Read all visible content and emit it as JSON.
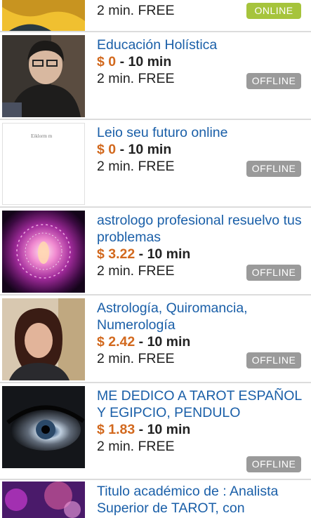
{
  "listings": [
    {
      "title": "",
      "currency": "",
      "price": "",
      "per": "",
      "free": "2 min. FREE",
      "status": "ONLINE"
    },
    {
      "title": "Educación Holística",
      "currency": "$",
      "price": "0",
      "per": "- 10 min",
      "free": "2 min. FREE",
      "status": "OFFLINE"
    },
    {
      "title": "Leio seu futuro online",
      "currency": "$",
      "price": "0",
      "per": "- 10 min",
      "free": "2 min. FREE",
      "status": "OFFLINE"
    },
    {
      "title": "astrologo profesional resuelvo tus problemas",
      "currency": "$",
      "price": "3.22",
      "per": "- 10 min",
      "free": "2 min. FREE",
      "status": "OFFLINE"
    },
    {
      "title": "Astrología, Quiromancia, Numerología",
      "currency": "$",
      "price": "2.42",
      "per": "- 10 min",
      "free": "2 min. FREE",
      "status": "OFFLINE"
    },
    {
      "title": "ME DEDICO A TAROT ESPAÑOL Y EGIPCIO, PENDULO",
      "currency": "$",
      "price": "1.83",
      "per": "- 10 min",
      "free": "2 min. FREE",
      "status": "OFFLINE"
    },
    {
      "title": "Titulo académico de : Analista Superior de TAROT, con",
      "currency": "",
      "price": "",
      "per": "",
      "free": "",
      "status": ""
    }
  ],
  "thumb_text": "Eiklorm m",
  "colors": {
    "title": "#1a5fa8",
    "price": "#d2691e",
    "online": "#a6c43c",
    "offline": "#9a9a9a"
  }
}
